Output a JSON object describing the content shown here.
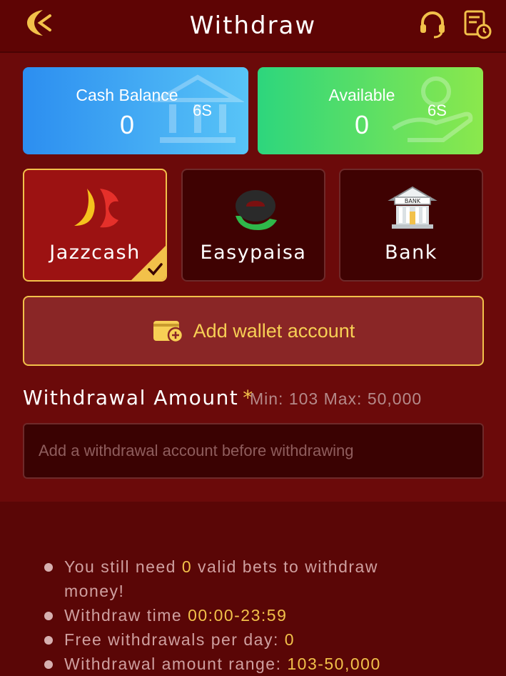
{
  "header": {
    "title": "Withdraw",
    "back_icon": "back-arrow-icon",
    "support_icon": "headset-icon",
    "record_icon": "record-list-icon"
  },
  "balances": {
    "cash": {
      "label": "Cash Balance",
      "value": "0",
      "unit": "6S",
      "icon": "bank-icon"
    },
    "available": {
      "label": "Available",
      "value": "0",
      "unit": "6S",
      "icon": "hand-coin-icon"
    }
  },
  "methods": [
    {
      "label": "Jazzcash",
      "icon": "jazzcash-icon",
      "selected": true
    },
    {
      "label": "Easypaisa",
      "icon": "easypaisa-icon",
      "selected": false
    },
    {
      "label": "Bank",
      "icon": "bank-building-icon",
      "selected": false
    }
  ],
  "add_wallet": {
    "label": "Add wallet account",
    "icon": "wallet-plus-icon"
  },
  "amount": {
    "title": "Withdrawal Amount",
    "asterisk": "*",
    "range": "Min: 103 Max: 50,000",
    "placeholder": "Add a withdrawal account before withdrawing"
  },
  "rules": {
    "r1_pre": "You still need ",
    "r1_hl": "0",
    "r1_post": " valid bets to withdraw money!",
    "r2_pre": "Withdraw time ",
    "r2_hl": "00:00-23:59",
    "r3_pre": "Free withdrawals per day: ",
    "r3_hl": "0",
    "r4_pre": "Withdrawal amount range: ",
    "r4_hl": "103-50,000"
  },
  "colors": {
    "background": "#5a0606",
    "accent_gold": "#f2c14a",
    "selected_tile": "#9c1212",
    "cash_card": "#2c8ef0",
    "available_card": "#2dd67d"
  }
}
